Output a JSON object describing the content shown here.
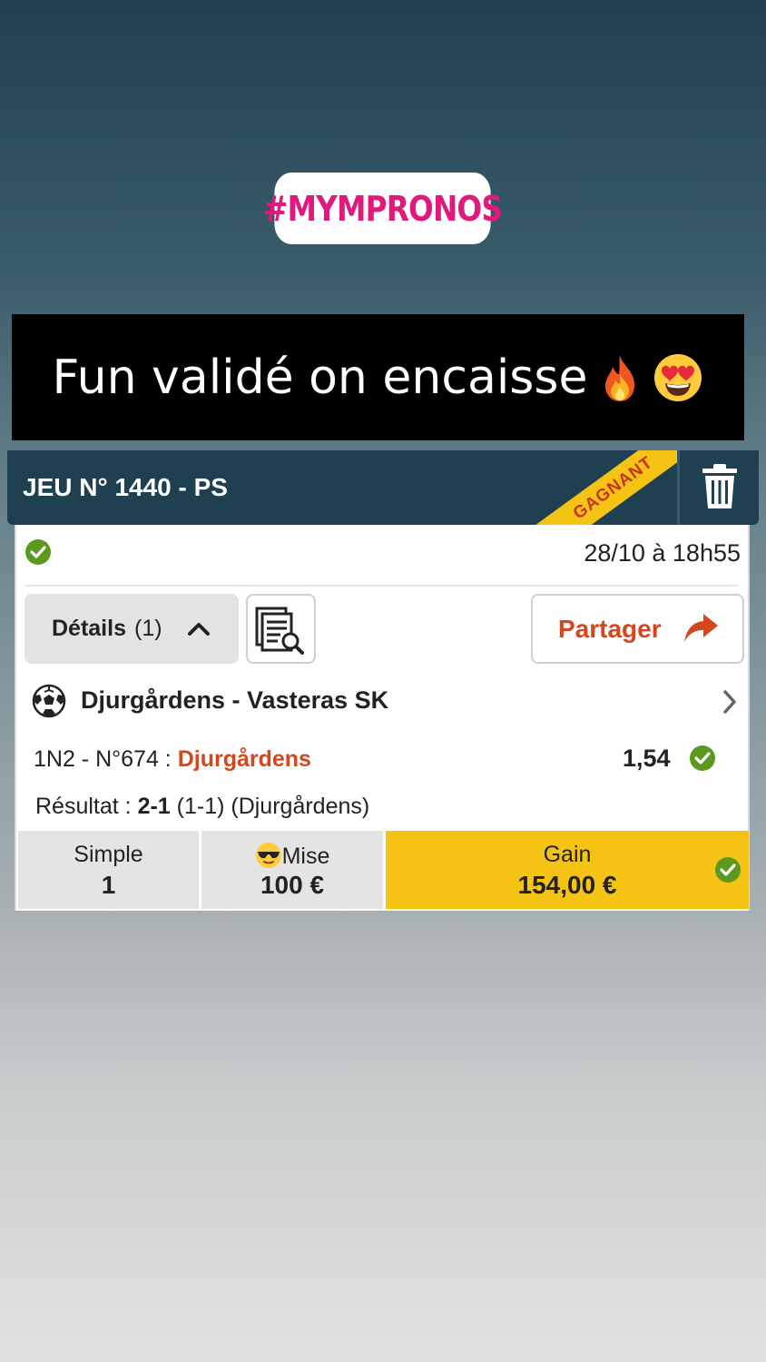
{
  "story": {
    "hashtag": "#MYMPRONOS",
    "caption": "Fun validé on encaisse",
    "caption_emojis": [
      "fire-emoji",
      "heart-eyes-emoji"
    ]
  },
  "bet": {
    "title": "JEU N° 1440 - PS",
    "ribbon": "GAGNANT",
    "date": "28/10 à 18h55",
    "details_label": "Détails",
    "details_count": "(1)",
    "share_label": "Partager",
    "match": "Djurgårdens - Vasteras SK",
    "pick_prefix": "1N2 - N°674 : ",
    "pick_team": "Djurgårdens",
    "odd": "1,54",
    "result_prefix": "Résultat : ",
    "result_score": "2-1",
    "result_rest": " (1-1) (Djurgårdens)",
    "type_label": "Simple",
    "type_value": "1",
    "stake_label": "Mise",
    "stake_value": "100 €",
    "gain_label": "Gain",
    "gain_value": "154,00 €"
  },
  "colors": {
    "accent_orange": "#d6461d",
    "gold": "#f5c314",
    "header": "#1e4050",
    "success_green": "#5b9a1f",
    "hashtag_pink": "#e0197d"
  }
}
